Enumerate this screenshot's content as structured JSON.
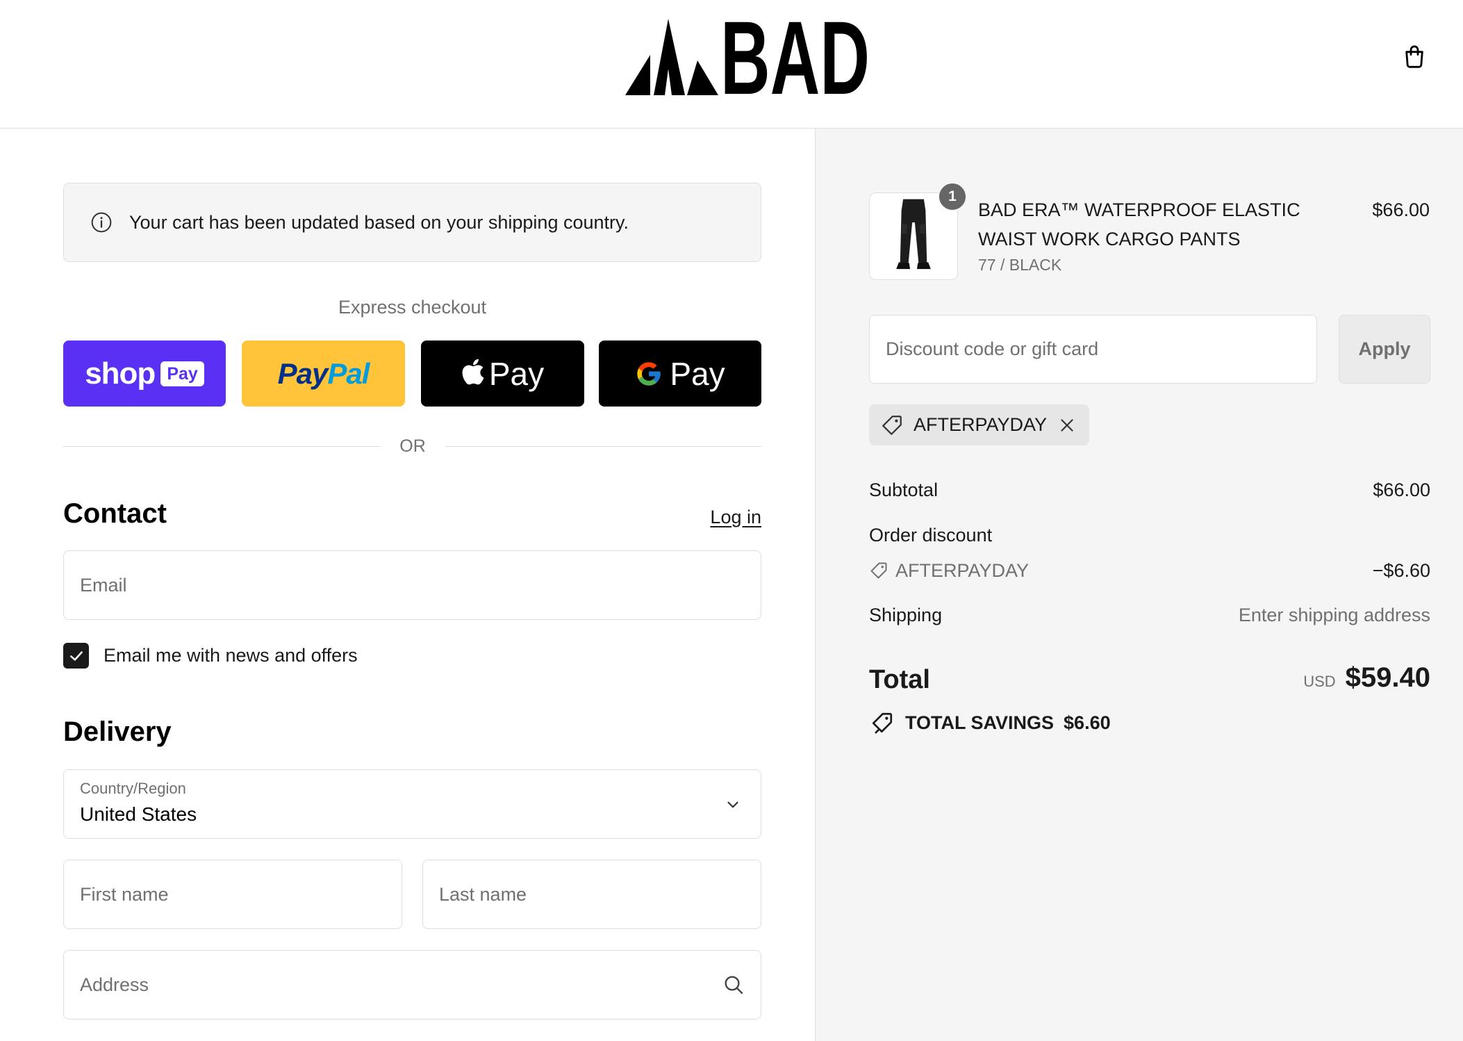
{
  "header": {
    "logo_text": "BAD",
    "logo_icon": "mountain-peaks-logo",
    "cart_icon": "shopping-bag-icon"
  },
  "notice": {
    "icon": "info-icon",
    "text": "Your cart has been updated based on your shipping country."
  },
  "express_checkout": {
    "label": "Express checkout",
    "shop_pay": {
      "wordmark": "shop",
      "badge": "Pay"
    },
    "paypal": {
      "part1": "Pay",
      "part2": "Pal"
    },
    "apple_pay": {
      "icon": "apple-logo-icon",
      "label": "Pay"
    },
    "google_pay": {
      "icon": "google-g-icon",
      "label": "Pay"
    }
  },
  "divider_label": "OR",
  "contact": {
    "heading": "Contact",
    "login_link": "Log in",
    "email_placeholder": "Email",
    "newsletter_label": "Email me with news and offers",
    "newsletter_checked": true
  },
  "delivery": {
    "heading": "Delivery",
    "country_label": "Country/Region",
    "country_value": "United States",
    "first_name_placeholder": "First name",
    "last_name_placeholder": "Last name",
    "address_placeholder": "Address"
  },
  "order_summary": {
    "items": [
      {
        "quantity": "1",
        "title": "BAD ERA™ WATERPROOF ELASTIC WAIST WORK CARGO PANTS",
        "variant": "77 / BLACK",
        "price": "$66.00"
      }
    ],
    "discount_placeholder": "Discount code or gift card",
    "apply_label": "Apply",
    "applied_code": "AFTERPAYDAY",
    "subtotal_label": "Subtotal",
    "subtotal_value": "$66.00",
    "order_discount_label": "Order discount",
    "discount_code": "AFTERPAYDAY",
    "discount_value": "−$6.60",
    "shipping_label": "Shipping",
    "shipping_value": "Enter shipping address",
    "total_label": "Total",
    "currency": "USD",
    "total_value": "$59.40",
    "savings_label": "TOTAL SAVINGS",
    "savings_value": "$6.60"
  },
  "colors": {
    "shop_pay": "#5a31f4",
    "paypal": "#ffc439",
    "paypal_dark_blue": "#003087",
    "paypal_light_blue": "#009cde",
    "wallet_buttons": "#000000",
    "summary_panel": "#f5f5f5",
    "text": "#1a1a1a",
    "muted_text": "#707070",
    "border": "#dedede"
  }
}
